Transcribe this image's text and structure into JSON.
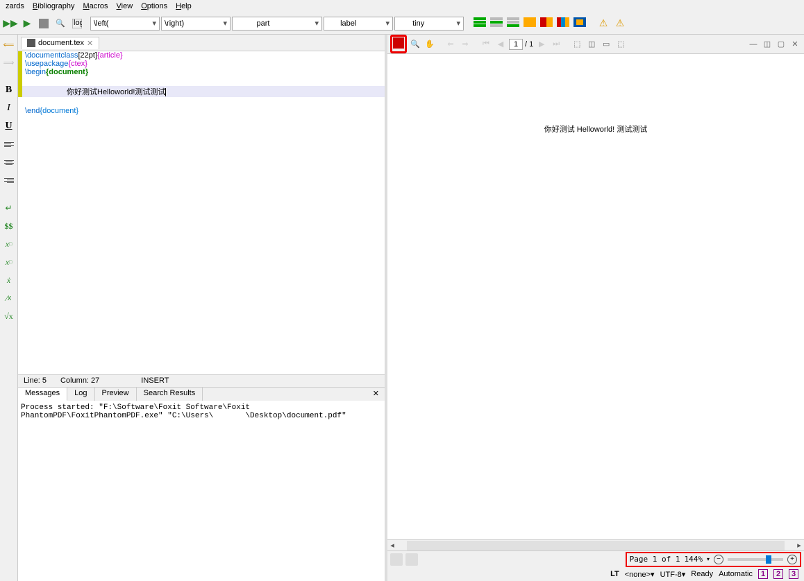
{
  "menu": {
    "items": [
      "zards",
      "Bibliography",
      "Macros",
      "View",
      "Options",
      "Help"
    ]
  },
  "toolbar": {
    "dd1": "\\left(",
    "dd2": "\\right)",
    "dd3": "part",
    "dd4": "label",
    "dd5": "tiny"
  },
  "tab": {
    "filename": "document.tex"
  },
  "code": {
    "l1_cmd": "\\documentclass",
    "l1_opt": "[22pt]",
    "l1_arg": "{article}",
    "l2_cmd": "\\usepackage",
    "l2_arg": "{ctex}",
    "l3_cmd": "\\begin",
    "l3_arg": "{document}",
    "l4_txt": "你好测试Helloworld!测试测试",
    "l5_cmd": "\\end",
    "l5_arg": "{document}"
  },
  "status": {
    "line": "Line: 5",
    "col": "Column: 27",
    "mode": "INSERT"
  },
  "btabs": {
    "t1": "Messages",
    "t2": "Log",
    "t3": "Preview",
    "t4": "Search Results"
  },
  "messages": "Process started: \"F:\\Software\\Foxit Software\\Foxit PhantomPDF\\FoxitPhantomPDF.exe\" \"C:\\Users\\       \\Desktop\\document.pdf\"",
  "preview": {
    "page_current": "1",
    "page_total": "/ 1",
    "content": "你好测试 Helloworld! 测试测试",
    "page_info": "Page 1 of 1",
    "zoom": "144%"
  },
  "status2": {
    "lt": "LT",
    "lang": "<none>",
    "enc": "UTF-8",
    "ready": "Ready",
    "auto": "Automatic"
  }
}
